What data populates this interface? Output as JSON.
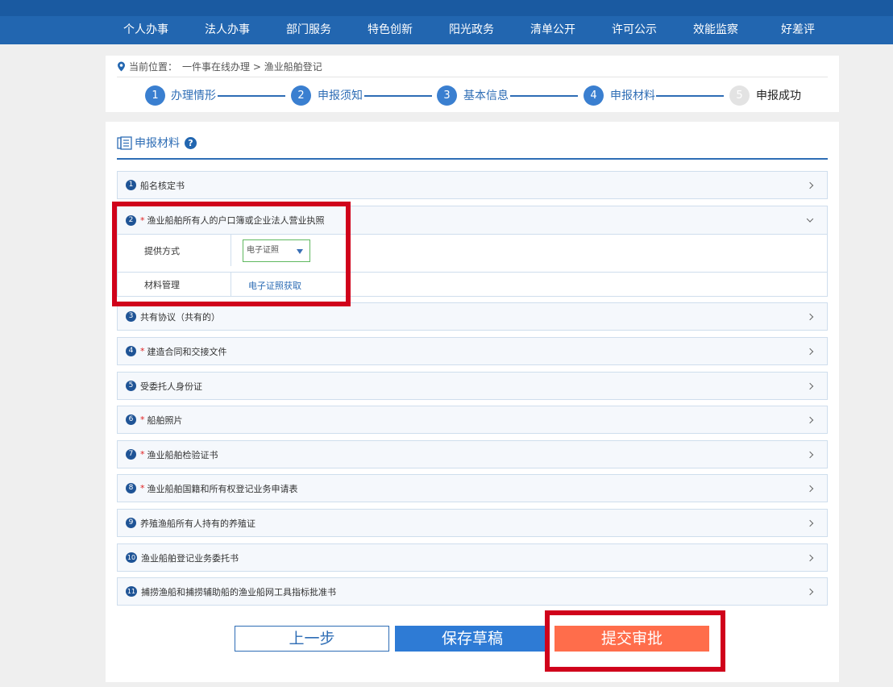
{
  "nav": [
    "个人办事",
    "法人办事",
    "部门服务",
    "特色创新",
    "阳光政务",
    "清单公开",
    "许可公示",
    "效能监察",
    "好差评"
  ],
  "breadcrumb": {
    "label": "当前位置：",
    "path": "一件事在线办理 > 渔业船舶登记",
    "icon": "location-pin-icon"
  },
  "steps": [
    {
      "num": "1",
      "label": "办理情形",
      "state": "done"
    },
    {
      "num": "2",
      "label": "申报须知",
      "state": "done"
    },
    {
      "num": "3",
      "label": "基本信息",
      "state": "done"
    },
    {
      "num": "4",
      "label": "申报材料",
      "state": "current"
    },
    {
      "num": "5",
      "label": "申报成功",
      "state": "pending"
    }
  ],
  "panel": {
    "title": "申报材料",
    "help_glyph": "?",
    "title_icon": "document-list-icon"
  },
  "materials": [
    {
      "num": "1",
      "name": "船名核定书",
      "required": false
    },
    {
      "num": "2",
      "name": "渔业船舶所有人的户口簿或企业法人营业执照",
      "required": true,
      "expanded": true
    },
    {
      "num": "3",
      "name": "共有协议（共有的）",
      "required": false
    },
    {
      "num": "4",
      "name": "建造合同和交接文件",
      "required": true
    },
    {
      "num": "5",
      "name": "受委托人身份证",
      "required": false
    },
    {
      "num": "6",
      "name": "船舶照片",
      "required": true
    },
    {
      "num": "7",
      "name": "渔业船舶检验证书",
      "required": true
    },
    {
      "num": "8",
      "name": "渔业船舶国籍和所有权登记业务申请表",
      "required": true
    },
    {
      "num": "9",
      "name": "养殖渔船所有人持有的养殖证",
      "required": false
    },
    {
      "num": "10",
      "name": "渔业船舶登记业务委托书",
      "required": false
    },
    {
      "num": "11",
      "name": "捕捞渔船和捕捞辅助船的渔业船网工具指标批准书",
      "required": false
    }
  ],
  "required_mark": "*",
  "expanded_detail": {
    "provide_label": "提供方式",
    "provide_value": "电子证照",
    "manage_label": "材料管理",
    "manage_link": "电子证照获取"
  },
  "buttons": {
    "prev": "上一步",
    "save": "保存草稿",
    "submit": "提交审批"
  },
  "colors": {
    "nav_bg": "#2266b0",
    "accent": "#2e6db5",
    "submit": "#ff6d4b",
    "highlight_box": "#d0021b"
  }
}
